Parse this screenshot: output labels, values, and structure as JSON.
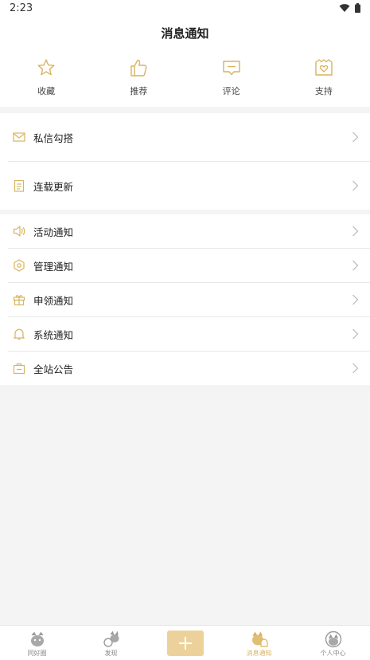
{
  "status_bar": {
    "time": "2:23"
  },
  "header": {
    "title": "消息通知"
  },
  "quick_actions": [
    {
      "label": "收藏",
      "icon": "star-icon"
    },
    {
      "label": "推荐",
      "icon": "thumbs-up-icon"
    },
    {
      "label": "评论",
      "icon": "comment-icon"
    },
    {
      "label": "支持",
      "icon": "heart-bag-icon"
    }
  ],
  "section1": [
    {
      "label": "私信勾搭",
      "icon": "mail-icon"
    },
    {
      "label": "连载更新",
      "icon": "document-icon"
    }
  ],
  "section2": [
    {
      "label": "活动通知",
      "icon": "speaker-icon"
    },
    {
      "label": "管理通知",
      "icon": "hexagon-icon"
    },
    {
      "label": "申领通知",
      "icon": "gift-icon"
    },
    {
      "label": "系统通知",
      "icon": "bell-icon"
    },
    {
      "label": "全站公告",
      "icon": "briefcase-icon"
    }
  ],
  "tab_bar": {
    "tabs": [
      {
        "label": "同好圈",
        "icon": "cat-circle-icon"
      },
      {
        "label": "发现",
        "icon": "cat-explore-icon"
      },
      {
        "label": "",
        "icon": "plus-icon"
      },
      {
        "label": "消息通知",
        "icon": "cat-bell-icon"
      },
      {
        "label": "个人中心",
        "icon": "cat-profile-icon"
      }
    ],
    "active_index": 3
  },
  "colors": {
    "accent": "#d9b45f",
    "add_button": "#ecd29a"
  }
}
